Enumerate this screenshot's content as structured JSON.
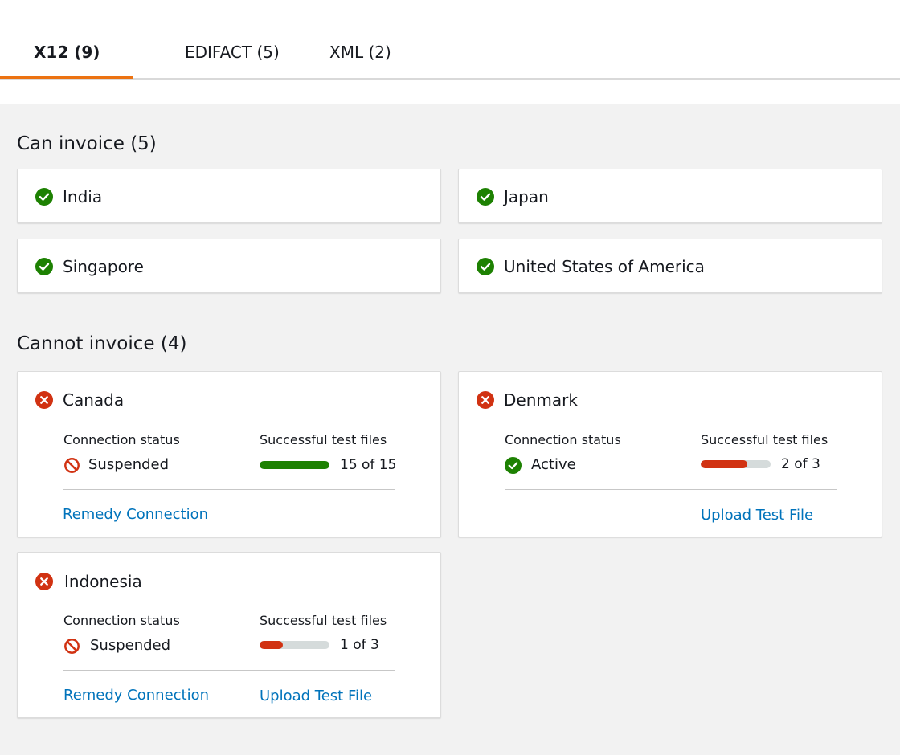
{
  "tabs": [
    {
      "label": "X12 (9)"
    },
    {
      "label": "EDIFACT (5)"
    },
    {
      "label": "XML (2)"
    }
  ],
  "colors": {
    "accent_tab": "#ec7211",
    "success": "#1d8102",
    "error": "#d13212",
    "link": "#0073bb",
    "progress_track": "#d5dbdb"
  },
  "can_invoice": {
    "title": "Can invoice (5)",
    "countries": [
      {
        "name": "India",
        "icon": "check-circle-icon"
      },
      {
        "name": "Japan",
        "icon": "check-circle-icon"
      },
      {
        "name": "Singapore",
        "icon": "check-circle-icon"
      },
      {
        "name": "United States of America",
        "icon": "check-circle-icon"
      }
    ]
  },
  "cannot_invoice": {
    "title": "Cannot invoice (4)",
    "countries": [
      {
        "name": "Canada",
        "icon": "x-circle-icon",
        "connection_label": "Connection status",
        "status": "Suspended",
        "status_icon": "ban-icon",
        "tests_label": "Successful test files",
        "tests_text": "15 of 15",
        "tests_fraction": 1.0,
        "tests_color": "#1d8102",
        "links": [
          "Remedy Connection"
        ]
      },
      {
        "name": "Denmark",
        "icon": "x-circle-icon",
        "connection_label": "Connection status",
        "status": "Active",
        "status_icon": "check-circle-icon",
        "tests_label": "Successful test files",
        "tests_text": "2 of 3",
        "tests_fraction": 0.667,
        "tests_color": "#d13212",
        "links": [
          "Upload Test File"
        ]
      },
      {
        "name": "Indonesia",
        "icon": "x-circle-icon",
        "connection_label": "Connection status",
        "status": "Suspended",
        "status_icon": "ban-icon",
        "tests_label": "Successful test files",
        "tests_text": "1 of 3",
        "tests_fraction": 0.333,
        "tests_color": "#d13212",
        "links": [
          "Remedy Connection",
          "Upload Test File"
        ]
      }
    ]
  }
}
